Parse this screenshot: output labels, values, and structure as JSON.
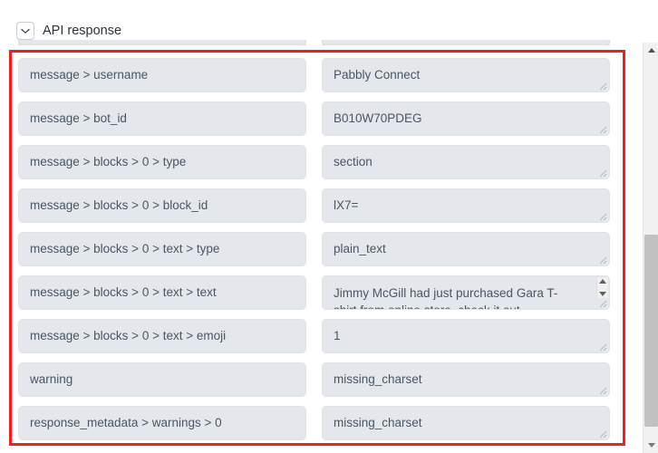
{
  "header": {
    "title": "API response",
    "collapse_icon": "chevron-down-icon"
  },
  "scrollbar": {
    "up_icon": "scroll-up-arrow-icon",
    "down_icon": "scroll-down-arrow-icon"
  },
  "annotation": {
    "highlight_color": "#fb1b1b"
  },
  "colors": {
    "field_background": "#e4e8ec",
    "field_border": "#dfe3e8",
    "text": "#4b5563",
    "title": "#2e3338"
  },
  "response_fields": [
    {
      "key": "message > username",
      "value": "Pabbly Connect",
      "multiline": false
    },
    {
      "key": "message > bot_id",
      "value": "B010W70PDEG",
      "multiline": false
    },
    {
      "key": "message > blocks > 0 > type",
      "value": "section",
      "multiline": false
    },
    {
      "key": "message > blocks > 0 > block_id",
      "value": "lX7=",
      "multiline": false
    },
    {
      "key": "message > blocks > 0 > text > type",
      "value": "plain_text",
      "multiline": false
    },
    {
      "key": "message > blocks > 0 > text > text",
      "value": "Jimmy McGill had just purchased Gara T-",
      "value_line2": "shirt from online store, check it out.",
      "multiline": true
    },
    {
      "key": "message > blocks > 0 > text > emoji",
      "value": "1",
      "multiline": false
    },
    {
      "key": "warning",
      "value": "missing_charset",
      "multiline": false
    },
    {
      "key": "response_metadata > warnings > 0",
      "value": "missing_charset",
      "multiline": false
    }
  ]
}
